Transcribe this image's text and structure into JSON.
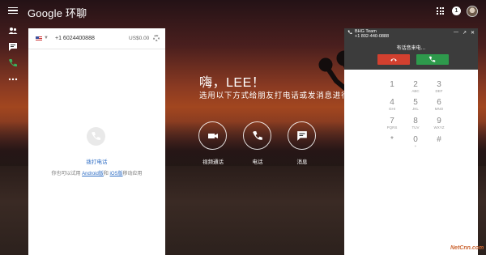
{
  "header": {
    "app_name": "Google 环聊",
    "notification_count": "1"
  },
  "rail": {
    "items": [
      "contacts-icon",
      "messages-icon",
      "phone-icon",
      "more-icon"
    ]
  },
  "left_card": {
    "phone_number": "+1 6024400888",
    "balance": "US$0.00",
    "dial_label": "拨打电话",
    "also_prefix": "你也可以试用 ",
    "android_link": "Android版",
    "and_text": "和 ",
    "ios_link": "iOS版",
    "also_suffix": "移动应用"
  },
  "main": {
    "greeting": "嗨，LEE！",
    "subtitle": "选用以下方式给朋友打电话或发消息进行",
    "actions": [
      {
        "label": "视频通话",
        "icon": "video-icon"
      },
      {
        "label": "电话",
        "icon": "phone-icon"
      },
      {
        "label": "消息",
        "icon": "message-icon"
      }
    ]
  },
  "call_panel": {
    "caller_name": "BHG Team",
    "caller_number": "+1 802-440-0888",
    "status": "有话音来电…",
    "decline_color": "#d2402f",
    "accept_color": "#2e9a4c",
    "keys": [
      {
        "d": "1",
        "l": ""
      },
      {
        "d": "2",
        "l": "ABC"
      },
      {
        "d": "3",
        "l": "DEF"
      },
      {
        "d": "4",
        "l": "GHI"
      },
      {
        "d": "5",
        "l": "JKL"
      },
      {
        "d": "6",
        "l": "MNO"
      },
      {
        "d": "7",
        "l": "PQRS"
      },
      {
        "d": "8",
        "l": "TUV"
      },
      {
        "d": "9",
        "l": "WXYZ"
      },
      {
        "d": "*",
        "l": ""
      },
      {
        "d": "0",
        "l": "+"
      },
      {
        "d": "#",
        "l": ""
      }
    ]
  },
  "watermark": "NetCnn.com"
}
